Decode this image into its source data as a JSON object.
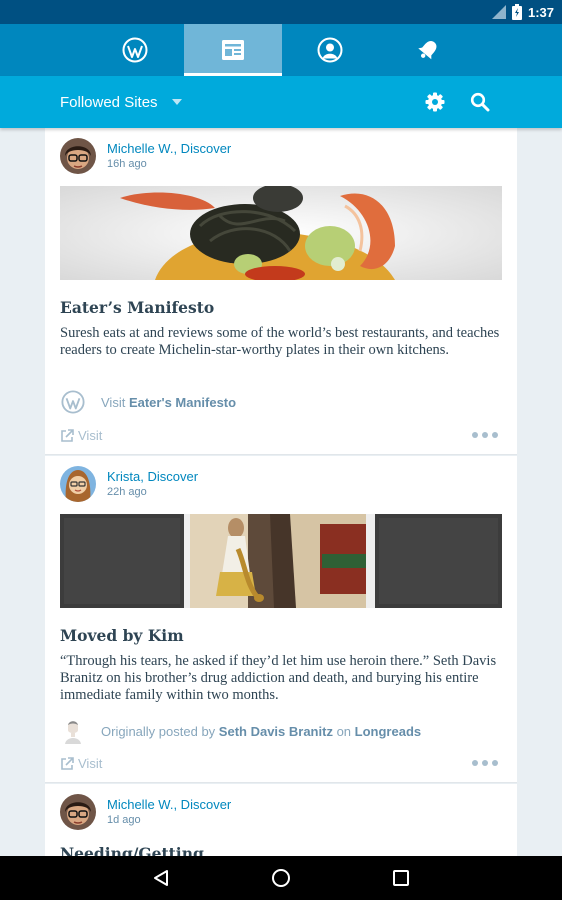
{
  "status_bar": {
    "time": "1:37"
  },
  "tabs": [
    {
      "id": "my-sites",
      "icon": "wordpress-icon"
    },
    {
      "id": "reader",
      "icon": "reader-icon",
      "active": true
    },
    {
      "id": "me",
      "icon": "me-icon"
    },
    {
      "id": "notifications",
      "icon": "bell-icon"
    }
  ],
  "toolbar": {
    "site_filter": "Followed Sites",
    "settings_icon": "gear-icon",
    "search_icon": "search-icon"
  },
  "posts": [
    {
      "author": "Michelle W., Discover",
      "time": "16h ago",
      "title": "Eater’s Manifesto",
      "excerpt": "Suresh eats at and reviews some of the world’s best restaurants, and teaches readers to create Michelin-star-worthy plates in their own kitchens.",
      "attribution": {
        "prefix": "Visit",
        "site": "Eater's Manifesto"
      },
      "visit_label": "Visit"
    },
    {
      "author": "Krista, Discover",
      "time": "22h ago",
      "title": "Moved by Kim",
      "excerpt": "“Through his tears, he asked if they’d let him use heroin there.” Seth Davis Branitz on his brother’s drug addiction and death, and burying his entire immediate family within two months.",
      "attribution": {
        "prefix": "Originally posted by",
        "person": "Seth Davis Branitz",
        "on": "on",
        "site": "Longreads"
      },
      "visit_label": "Visit"
    },
    {
      "author": "Michelle W., Discover",
      "time": "1d ago",
      "title": "Needing/Getting"
    }
  ],
  "colors": {
    "status_bar": "#005082",
    "tab_bar": "#0087be",
    "toolbar": "#00aadc",
    "link_blue": "#0087be",
    "text_dark": "#2e4453",
    "muted": "#87a6bc"
  }
}
